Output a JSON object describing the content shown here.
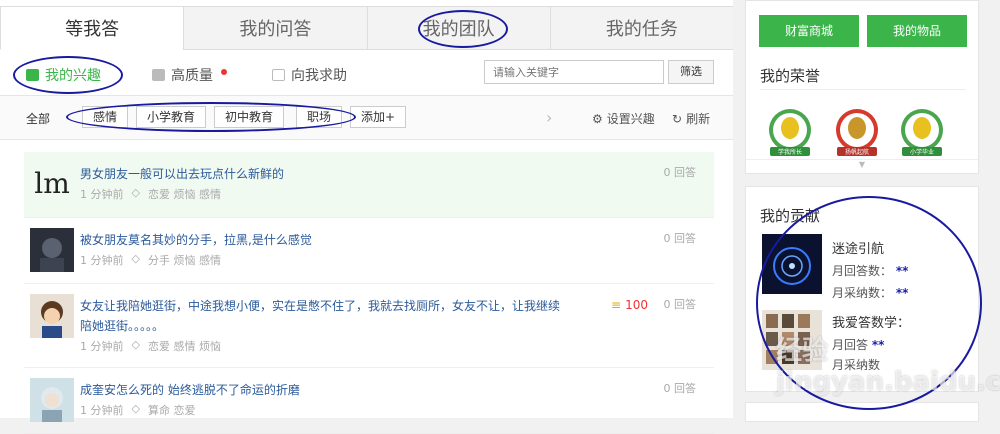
{
  "tabs": [
    "等我答",
    "我的问答",
    "我的团队",
    "我的任务"
  ],
  "subtabs": {
    "interest": "我的兴趣",
    "quality": "高质量",
    "ask_me": "向我求助"
  },
  "search": {
    "placeholder": "请输入关键字",
    "filter_label": "筛选"
  },
  "tagbar": {
    "all_label": "全部",
    "tags": [
      "感情",
      "小学教育",
      "初中教育",
      "职场"
    ],
    "add_label": "添加+",
    "set_interest_label": "设置兴趣",
    "refresh_label": "刷新"
  },
  "questions": [
    {
      "title": "男女朋友一般可以出去玩点什么新鲜的",
      "time": "1 分钟前",
      "tags": "恋爱  烦恼  感情",
      "answers": "0 回答",
      "avatar_text": "lm"
    },
    {
      "title": "被女朋友莫名其妙的分手，拉黑,是什么感觉",
      "time": "1 分钟前",
      "tags": "分手  烦恼  感情",
      "answers": "0 回答"
    },
    {
      "title": "女友让我陪她逛街，中途我想小便，实在是憋不住了，我就去找厕所，女友不让，让我继续",
      "title2": "陪她逛街。。。。。",
      "time": "1 分钟前",
      "tags": "恋爱  感情  烦恼",
      "answers": "0 回答",
      "bounty": "100"
    },
    {
      "title": "成奎安怎么死的 始终逃脱不了命运的折磨",
      "time": "1 分钟前",
      "tags": "算命  恋爱",
      "answers": "0 回答"
    }
  ],
  "sidebar": {
    "wealth_btn": "财富商城",
    "items_btn": "我的物品",
    "honor_title": "我的荣誉",
    "badges": [
      "学我所长",
      "扬帆起航",
      "小学毕业"
    ],
    "contrib_title": "我的贡献",
    "contrib1": {
      "name": "迷途引航",
      "monthly_answers": "月回答数：",
      "monthly_adopted": "月采纳数：",
      "stars": "**"
    },
    "contrib2": {
      "name": "我爱答数学：",
      "monthly_answers": "月回答",
      "monthly_adopted": "月采纳数"
    }
  },
  "colors": {
    "accent": "#3bb54a",
    "annotation": "#1a1aa0",
    "link": "#2a5a9a"
  },
  "watermark": "经验 jingyan.baidu.com"
}
